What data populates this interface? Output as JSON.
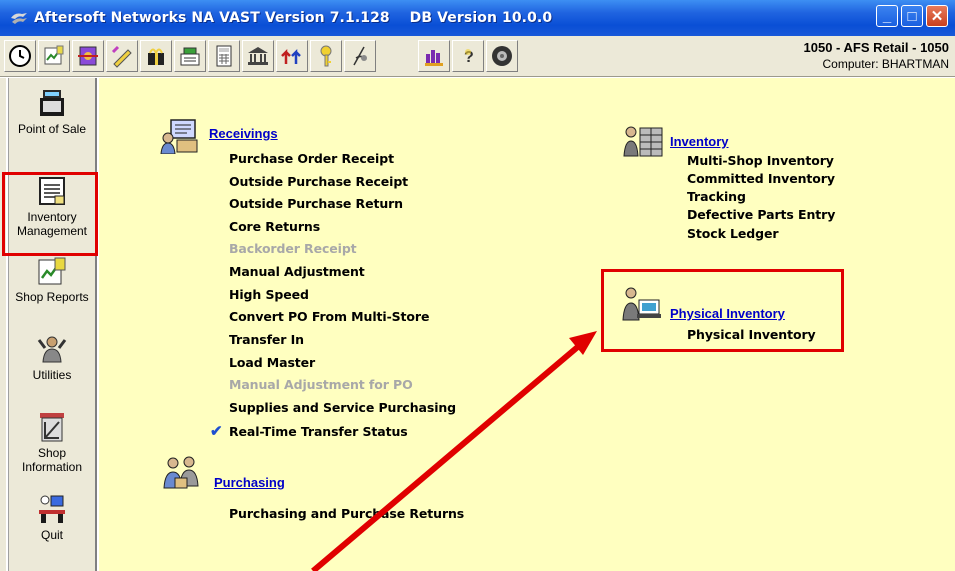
{
  "window": {
    "title": "Aftersoft Networks NA VAST Version 7.1.128    DB Version 10.0.0",
    "minimize_label": "_",
    "maximize_label": "□",
    "close_label": "✕"
  },
  "toolbar": {
    "icons": [
      "clock-icon",
      "report-icon",
      "parts-icon",
      "pencil-icon",
      "gift-icon",
      "register-icon",
      "calculator-icon",
      "bank-icon",
      "arrows-icon",
      "key-icon",
      "document-icon",
      "people-icon",
      "help-icon",
      "tire-icon"
    ],
    "store_name": "1050 - AFS Retail - 1050",
    "computer": "Computer: BHARTMAN"
  },
  "sidebar": {
    "items": [
      {
        "label": "Point of Sale",
        "icon": "cash-register-icon"
      },
      {
        "label": "Inventory Management",
        "icon": "inventory-list-icon"
      },
      {
        "label": "Shop Reports",
        "icon": "chart-report-icon"
      },
      {
        "label": "Utilities",
        "icon": "wrench-person-icon"
      },
      {
        "label": "Shop Information",
        "icon": "drafting-tools-icon"
      },
      {
        "label": "Quit",
        "icon": "exit-desk-icon"
      }
    ]
  },
  "main": {
    "receivings": {
      "title": "Receivings",
      "items": [
        {
          "label": "Purchase Order Receipt",
          "enabled": true
        },
        {
          "label": "Outside Purchase Receipt",
          "enabled": true
        },
        {
          "label": "Outside Purchase Return",
          "enabled": true
        },
        {
          "label": "Core Returns",
          "enabled": true
        },
        {
          "label": "Backorder Receipt",
          "enabled": false
        },
        {
          "label": "Manual Adjustment",
          "enabled": true
        },
        {
          "label": "High Speed",
          "enabled": true
        },
        {
          "label": "Convert PO From Multi-Store",
          "enabled": true
        },
        {
          "label": "Transfer In",
          "enabled": true
        },
        {
          "label": "Load Master",
          "enabled": true
        },
        {
          "label": "Manual Adjustment for PO",
          "enabled": false
        },
        {
          "label": "Supplies and Service Purchasing",
          "enabled": true
        },
        {
          "label": "Real-Time Transfer Status",
          "enabled": true,
          "checked": true
        }
      ]
    },
    "purchasing": {
      "title": "Purchasing",
      "items": [
        {
          "label": "Purchasing and Purchase Returns",
          "enabled": true
        }
      ]
    },
    "inventory": {
      "title": "Inventory",
      "items": [
        {
          "label": "Multi-Shop Inventory",
          "enabled": true
        },
        {
          "label": "Committed Inventory",
          "enabled": true
        },
        {
          "label": "Tracking",
          "enabled": true
        },
        {
          "label": "Defective Parts Entry",
          "enabled": true
        },
        {
          "label": "Stock Ledger",
          "enabled": true
        }
      ]
    },
    "physical_inventory": {
      "title": "Physical Inventory",
      "items": [
        {
          "label": "Physical Inventory",
          "enabled": true
        }
      ]
    }
  },
  "annotations": {
    "highlight_color": "#e00000",
    "check_glyph": "✔"
  }
}
